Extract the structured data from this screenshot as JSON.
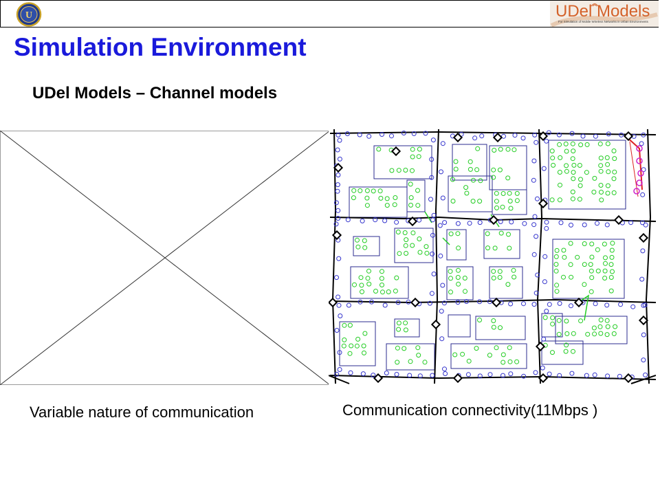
{
  "header": {
    "brand_text": "UDel Models",
    "brand_subtitle": "For Simulation of Mobile Wireless Networks in Urban Environments"
  },
  "slide": {
    "title": "Simulation Environment",
    "subtitle": "UDel Models – Channel models"
  },
  "captions": {
    "left": "Variable nature of communication",
    "right": "Communication connectivity(11Mbps )"
  },
  "colors": {
    "title": "#1a1adb",
    "brand": "#d4622a",
    "building_outline": "#2b2b8f",
    "node_green": "#22cc22",
    "node_blue": "#3333cc",
    "link_red": "#dd2222",
    "road": "#000000"
  },
  "icons": {
    "university_logo": "ud-seal-icon",
    "missing_image": "broken-image-placeholder-icon"
  }
}
